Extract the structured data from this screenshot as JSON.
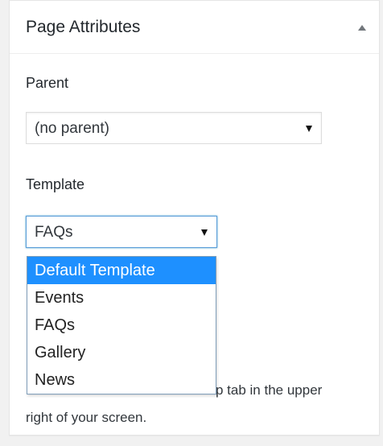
{
  "panel": {
    "title": "Page Attributes",
    "toggle_icon": "triangle-up-icon"
  },
  "parent": {
    "label": "Parent",
    "selected": "(no parent)"
  },
  "template": {
    "label": "Template",
    "selected": "FAQs",
    "highlighted_option": "Default Template",
    "options": [
      "Default Template",
      "Events",
      "FAQs",
      "Gallery",
      "News"
    ]
  },
  "help": {
    "visible_fragment": "p tab in the upper",
    "line2": "right of your screen."
  },
  "colors": {
    "highlight": "#1e90ff",
    "focus_border": "#5b9dd9"
  }
}
